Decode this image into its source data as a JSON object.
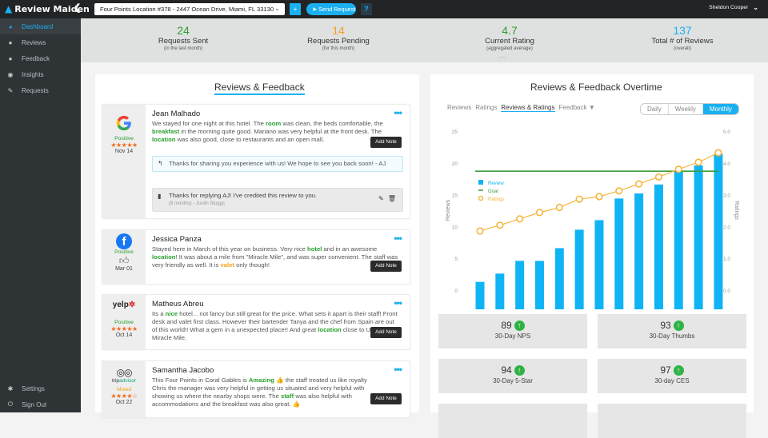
{
  "app": {
    "brand": "Review Maiden",
    "collapse_icon": "chevron-left"
  },
  "topbar": {
    "location_select": "Four Points Location #378 - 2447 Ocean Drive, Miami, FL 33130",
    "plus_label": "+",
    "send_request_label": "Send Request",
    "help_label": "?",
    "user_name": "Sheldon Cooper"
  },
  "sidebar": {
    "items": [
      {
        "label": "Dashboard",
        "icon": "dashboard-icon",
        "active": true
      },
      {
        "label": "Reviews",
        "icon": "comments-icon"
      },
      {
        "label": "Feedback",
        "icon": "comment-icon"
      },
      {
        "label": "Insights",
        "icon": "eye-icon"
      },
      {
        "label": "Requests",
        "icon": "edit-icon"
      }
    ],
    "bottom": [
      {
        "label": "Settings",
        "icon": "gear-icon"
      },
      {
        "label": "Sign Out",
        "icon": "power-icon"
      }
    ]
  },
  "stats": [
    {
      "value": "24",
      "label": "Requests Sent",
      "sub": "(in the last month)",
      "color": "#2e9e33"
    },
    {
      "value": "14",
      "label": "Requests Pending",
      "sub": "(for this month)",
      "color": "#f7a21b"
    },
    {
      "value": "4.7",
      "label": "Current Rating",
      "sub": "(aggregated average)",
      "color": "#2e9e33"
    },
    {
      "value": "137",
      "label": "Total # of Reviews",
      "sub": "(overall)",
      "color": "#1ab0f0"
    }
  ],
  "reviews_panel": {
    "title": "Reviews & Feedback",
    "add_note_label": "Add Note",
    "reviews": [
      {
        "source": "Google",
        "sentiment": "Positive",
        "stars": "★★★★★",
        "date": "Nov 14",
        "name": "Jean Malhado",
        "segments": [
          [
            "We stayed for one night at this hotel. The ",
            ""
          ],
          [
            "room",
            "kw"
          ],
          [
            " was clean, the beds comfortable, the ",
            ""
          ],
          [
            "breakfast",
            "kw"
          ],
          [
            " in the morning quite good. Mariano was very helpful at the front desk. The ",
            ""
          ],
          [
            "location",
            "kw"
          ],
          [
            " was also good, close to restaurants and an open mall.",
            ""
          ]
        ],
        "reply": "Thanks for sharing you experience with us! We hope to see you back soon! - AJ",
        "note": {
          "text": "Thanks for replying AJ! I've credited this review to you.",
          "meta": "(8 months) - Justin Stuggs"
        }
      },
      {
        "source": "Facebook",
        "sentiment": "Positive",
        "stars": "thumbs-up",
        "date": "Mar 01",
        "name": "Jessica Panza",
        "segments": [
          [
            "Stayed here in March of this year on business. Very nice ",
            ""
          ],
          [
            "hotel",
            "kw"
          ],
          [
            " and in an awesome ",
            ""
          ],
          [
            "location",
            "kw"
          ],
          [
            "! It was about a mile from \"Miracle Mile\", and was super convenient. The staff was very friendly as well. It is ",
            ""
          ],
          [
            "valet",
            "kw-o"
          ],
          [
            " only though!",
            ""
          ]
        ]
      },
      {
        "source": "Yelp",
        "sentiment": "Positive",
        "stars": "★★★★★",
        "date": "Oct 14",
        "name": "Matheus Abreu",
        "segments": [
          [
            "Its a ",
            ""
          ],
          [
            "nice",
            "kw"
          ],
          [
            " hotel... not fancy but still great for the price. What sets it apart is their staff! Front desk and valet first class. However their bartender Tanya and the chef from Spain are out of this world!! What a gem in a unexpected place!! And great ",
            ""
          ],
          [
            "location",
            "kw"
          ],
          [
            " close to UM and Miracle Mile.",
            ""
          ]
        ]
      },
      {
        "source": "TripAdvisor",
        "sentiment": "Mixed",
        "stars": "★★★★☆",
        "date": "Oct 22",
        "name": "Samantha Jacobo",
        "segments": [
          [
            "This Four Points in Coral Gables is ",
            ""
          ],
          [
            "Amazing",
            "kw"
          ],
          [
            " 👍 the staff treated us like royalty Chris the manager was very helpful in getting us situated and very helpful with showing us where the nearby shops were. The ",
            ""
          ],
          [
            "staff",
            "kw"
          ],
          [
            " was also helpful with accommodations and the breakfast was also great. 👍",
            ""
          ]
        ]
      }
    ]
  },
  "overtime_panel": {
    "title": "Reviews & Feedback Overtime",
    "tabs": [
      "Reviews",
      "Ratings",
      "Reviews & Ratings",
      "Feedback ▼"
    ],
    "active_tab": "Reviews & Ratings",
    "periods": [
      "Daily",
      "Weekly",
      "Monthly"
    ],
    "active_period": "Monthly"
  },
  "chart_data": {
    "type": "bar",
    "title": "",
    "xlabel": "",
    "ylabel": "Reviews",
    "y2label": "Ratings",
    "ylim": [
      0,
      25
    ],
    "y2lim": [
      0,
      5
    ],
    "yticks": [
      "0",
      "5",
      "10",
      "15",
      "20",
      "25"
    ],
    "y2ticks": [
      "0.0",
      "1.0",
      "2.0",
      "3.0",
      "4.0",
      "5.0"
    ],
    "legend": [
      "Review",
      "Goal",
      "Ratings"
    ],
    "legend_position": "left",
    "series": [
      {
        "name": "Review",
        "type": "bar",
        "color": "#0fb4f5",
        "values": [
          1.3,
          2.6,
          4.6,
          4.6,
          6.6,
          9.5,
          11.0,
          14.4,
          15.2,
          16.6,
          18.7,
          19.6,
          21.4
        ]
      },
      {
        "name": "Goal",
        "type": "hline",
        "color": "#3e9b3e",
        "value": 18.7
      },
      {
        "name": "Ratings",
        "type": "line",
        "axis": "right",
        "color": "#f5b53c",
        "values": [
          1.86,
          2.04,
          2.24,
          2.44,
          2.6,
          2.86,
          2.94,
          3.12,
          3.34,
          3.56,
          3.8,
          4.02,
          4.32
        ]
      }
    ]
  },
  "kpis": [
    {
      "value": "89",
      "label": "30-Day NPS",
      "trend": "up"
    },
    {
      "value": "93",
      "label": "30-Day Thumbs",
      "trend": "up"
    },
    {
      "value": "94",
      "label": "30-Day 5-Star",
      "trend": "up"
    },
    {
      "value": "97",
      "label": "30-day CES",
      "trend": "up"
    }
  ]
}
